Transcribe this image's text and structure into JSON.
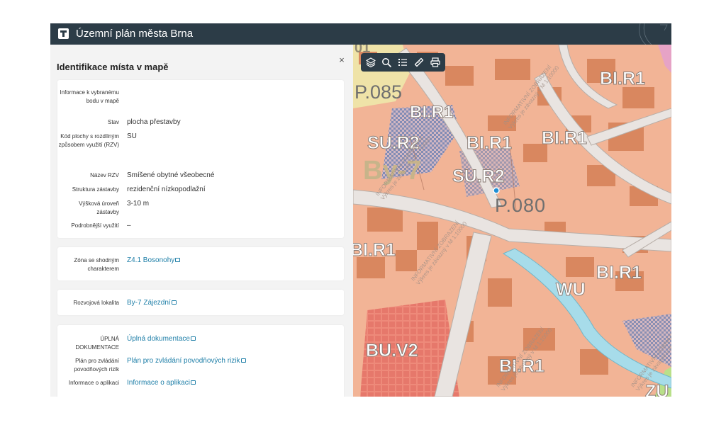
{
  "header": {
    "title": "Územní plán města Brna",
    "logo_icon": "t-logo-icon"
  },
  "panel": {
    "title": "Identifikace místa v mapě",
    "close_label": "×",
    "info_rows": [
      {
        "label": "Informace k vybranému bodu v mapě",
        "value": ""
      },
      {
        "label": "Stav",
        "value": "plocha přestavby"
      },
      {
        "label": "Kód plochy s rozdílným způsobem využití (RZV)",
        "value": "SU"
      },
      {
        "label": "Název RZV",
        "value": "Smíšené obytné všeobecné"
      },
      {
        "label": "Struktura zástavby",
        "value": "rezidenční nízkopodlažní"
      },
      {
        "label": "Výšková úroveň zástavby",
        "value": "3-10 m"
      },
      {
        "label": "Podrobnější využití",
        "value": "–"
      }
    ],
    "zona": {
      "label": "Zóna se shodným charakterem",
      "value": "Z4.1 Bosonohy"
    },
    "lokalita": {
      "label": "Rozvojová lokalita",
      "value": "By-7 Zájezdní"
    },
    "docs": [
      {
        "label": "ÚPLNÁ DOKUMENTACE",
        "value": "Úplná dokumentace"
      },
      {
        "label": "Plán pro zvládání povodňových rizik",
        "value": "Plán pro zvládání povodňových rizik"
      },
      {
        "label": "Informace o aplikaci",
        "value": "Informace o aplikaci"
      }
    ]
  },
  "toolbar": {
    "icons": [
      "layers-icon",
      "search-icon",
      "legend-list-icon",
      "measure-ruler-icon",
      "print-icon"
    ]
  },
  "map": {
    "labels": {
      "p085": "P.085",
      "bir1_a": "BI.R1",
      "bir1_b": "BI.R1",
      "bir1_c": "BI.R1",
      "bir1_d": "BI.R1",
      "bir1_e": "BI.R1",
      "bir1_f": "BI.R1",
      "bir1_g": "BI.R1",
      "sur2_a": "SU.R2",
      "sur2_b": "SU.R2",
      "by7": "By-7",
      "p080": "P.080",
      "wu": "WU",
      "buv2": "BU.V2",
      "zu": "ZU",
      "top_label": "01"
    },
    "watermark_line1": "INFORMATIVNÍ ZOBRAZENÍ",
    "watermark_line2": "Výkres je závazný v M 1:10000",
    "colors": {
      "base": "#f2b496",
      "building": "#d9875f",
      "road": "#e9e4e1",
      "water": "#a7dcea",
      "yellow_zone": "#efe3a8",
      "red_zone": "#ee8a7a",
      "pin": "#1f8fd6",
      "header": "#2c3c47",
      "link": "#1f7fa8"
    }
  }
}
